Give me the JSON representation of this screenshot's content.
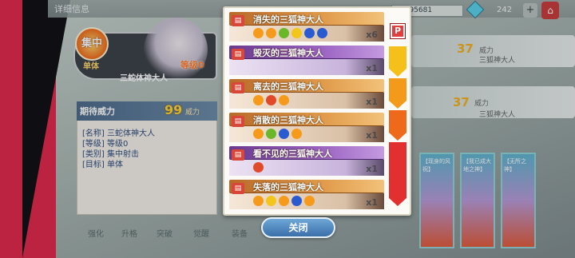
{
  "header": {
    "title": "详细信息",
    "resource_value": "3795681",
    "gem_count": "242"
  },
  "card": {
    "badge": "集中",
    "type": "单体",
    "level": "等级0",
    "name": "三蛇体神大人"
  },
  "info": {
    "power_label": "期待威力",
    "power_value": "99",
    "power_unit": "威力",
    "lines": [
      "[名称] 三蛇体神大人",
      "[等级] 等级0",
      "[类别] 集中射击",
      "[目标] 单体"
    ]
  },
  "modal": {
    "p_label": "P",
    "entries": [
      {
        "name": "消失的三狐神大人",
        "mult": "x6",
        "color": "orange",
        "skills": [
          {
            "name": "orange-person",
            "color": "orange"
          },
          {
            "name": "orange-flame",
            "color": "orange"
          },
          {
            "name": "green-swirl",
            "color": "green"
          },
          {
            "name": "yellow-moon",
            "color": "yellow"
          },
          {
            "name": "blue-moon",
            "color": "blue"
          },
          {
            "name": "blue-shield",
            "color": "blue"
          }
        ]
      },
      {
        "name": "毁灭的三狐神大人",
        "mult": "x1",
        "color": "purple",
        "skills": []
      },
      {
        "name": "离去的三狐神大人",
        "mult": "x1",
        "color": "orange",
        "skills": [
          {
            "name": "orange-person",
            "color": "orange"
          },
          {
            "name": "red-burst",
            "color": "red"
          },
          {
            "name": "orange-swirl",
            "color": "orange"
          }
        ]
      },
      {
        "name": "消散的三狐神大人",
        "mult": "x1",
        "color": "orange",
        "skills": [
          {
            "name": "orange-person",
            "color": "orange"
          },
          {
            "name": "green-swirl",
            "color": "green"
          },
          {
            "name": "blue-moon",
            "color": "blue"
          },
          {
            "name": "orange-spark",
            "color": "orange"
          }
        ]
      },
      {
        "name": "看不见的三狐神大人",
        "mult": "x1",
        "color": "purple",
        "skills": [
          {
            "name": "red-burst",
            "color": "red"
          }
        ]
      },
      {
        "name": "失落的三狐神大人",
        "mult": "x1",
        "color": "orange",
        "skills": [
          {
            "name": "orange-person",
            "color": "orange"
          },
          {
            "name": "yellow-moon",
            "color": "yellow"
          },
          {
            "name": "orange-star",
            "color": "orange"
          },
          {
            "name": "blue-moon",
            "color": "blue"
          },
          {
            "name": "orange-spark",
            "color": "orange"
          }
        ]
      }
    ],
    "close_label": "关闭"
  },
  "right_panel": {
    "power_value": "37",
    "power_label": "威力",
    "name": "三狐神大人",
    "power_value_2": "37",
    "power_label_2": "威力",
    "name_2": "三狐神大人"
  },
  "bottom_cards": [
    "【现身的风祝】",
    "【我已成大地之神】",
    "【无所之神】"
  ],
  "tabs": [
    "强化",
    "升格",
    "突破",
    "觉醒",
    "装备"
  ]
}
